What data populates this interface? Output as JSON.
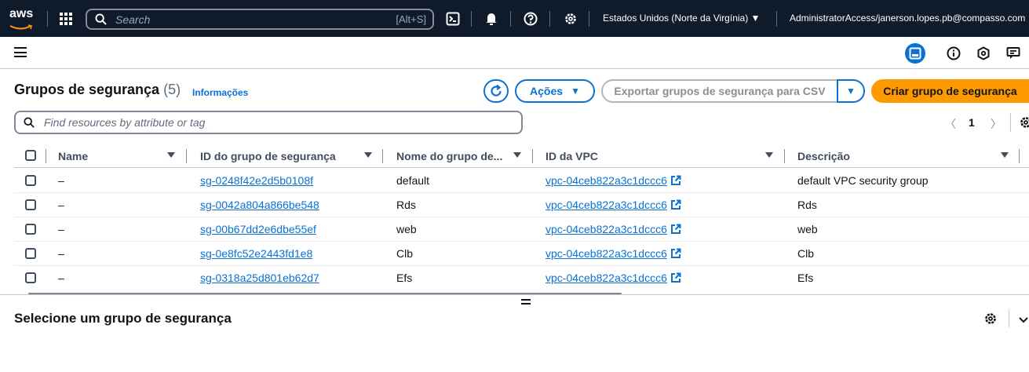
{
  "topnav": {
    "logo": "aws",
    "search_placeholder": "Search",
    "search_shortcut": "[Alt+S]",
    "icons": [
      "services-grid-icon",
      "cloudshell-icon",
      "bell-icon",
      "help-icon",
      "gear-icon"
    ],
    "region": "Estados Unidos (Norte da Virgínia)",
    "account": "AdministratorAccess/janerson.lopes.pb@compasso.com"
  },
  "header": {
    "title": "Grupos de segurança",
    "count": "(5)",
    "info_link": "Informações",
    "actions_label": "Ações",
    "export_label": "Exportar grupos de segurança para CSV",
    "create_label": "Criar grupo de segurança"
  },
  "filter": {
    "placeholder": "Find resources by attribute or tag"
  },
  "pagination": {
    "current_page": "1"
  },
  "table": {
    "columns": [
      "Name",
      "ID do grupo de segurança",
      "Nome do grupo de...",
      "ID da VPC",
      "Descrição"
    ],
    "rows": [
      {
        "name": "–",
        "sg_id": "sg-0248f42e2d5b0108f",
        "group_name": "default",
        "vpc_id": "vpc-04ceb822a3c1dccc6",
        "description": "default VPC security group"
      },
      {
        "name": "–",
        "sg_id": "sg-0042a804a866be548",
        "group_name": "Rds",
        "vpc_id": "vpc-04ceb822a3c1dccc6",
        "description": "Rds"
      },
      {
        "name": "–",
        "sg_id": "sg-00b67dd2e6dbe55ef",
        "group_name": "web",
        "vpc_id": "vpc-04ceb822a3c1dccc6",
        "description": "web"
      },
      {
        "name": "–",
        "sg_id": "sg-0e8fc52e2443fd1e8",
        "group_name": "Clb",
        "vpc_id": "vpc-04ceb822a3c1dccc6",
        "description": "Clb"
      },
      {
        "name": "–",
        "sg_id": "sg-0318a25d801eb62d7",
        "group_name": "Efs",
        "vpc_id": "vpc-04ceb822a3c1dccc6",
        "description": "Efs"
      }
    ]
  },
  "detail_panel": {
    "title": "Selecione um grupo de segurança"
  },
  "colors": {
    "nav_bg": "#0f1b2a",
    "accent": "#0972d3",
    "primary_button": "#ff9900"
  }
}
